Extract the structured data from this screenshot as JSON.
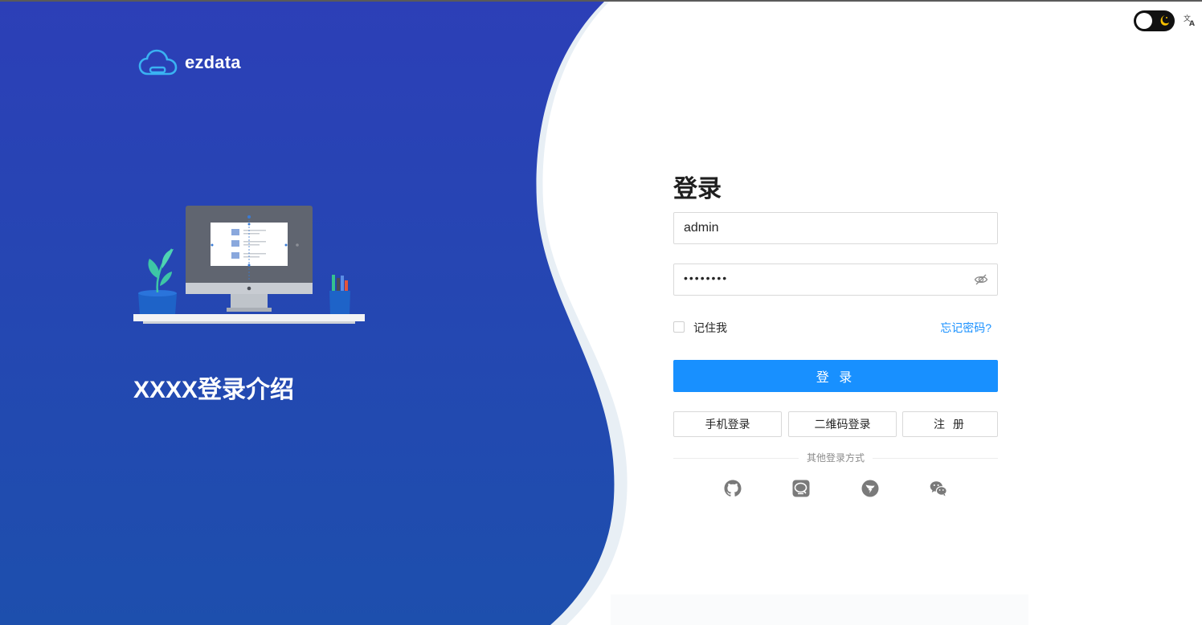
{
  "brand": {
    "name": "ezdata"
  },
  "intro": {
    "text": "XXXX登录介绍"
  },
  "login_form": {
    "title": "登录",
    "username_value": "admin",
    "password_mask": "••••••••",
    "remember_label": "记住我",
    "forgot_label": "忘记密码?",
    "submit_label": "登 录",
    "phone_login_label": "手机登录",
    "qr_login_label": "二维码登录",
    "register_label": "注 册",
    "other_methods_label": "其他登录方式"
  },
  "social_icons": [
    "github-icon",
    "qq-chat-icon",
    "dingtalk-icon",
    "wechat-icon"
  ],
  "theme": {
    "left_panel_top": "#2b43b8",
    "left_panel_bottom": "#1c4fb0",
    "primary": "#1890ff",
    "toggle_bg": "#111111",
    "moon": "#f6c000"
  }
}
